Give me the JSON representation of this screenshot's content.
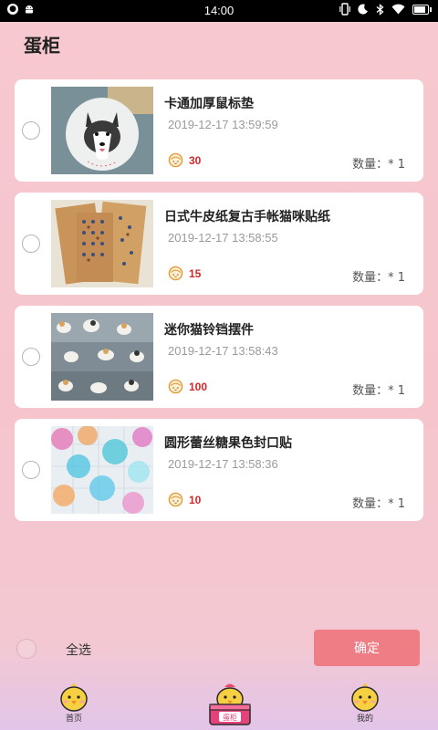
{
  "status_bar": {
    "time": "14:00",
    "left_icons": [
      "notification-dot-icon",
      "android-icon"
    ],
    "right_icons": [
      "vibrate-icon",
      "do-not-disturb-icon",
      "bluetooth-icon",
      "wifi-icon",
      "battery-icon"
    ],
    "battery_level": 0.85
  },
  "page": {
    "title": "蛋柜"
  },
  "items": [
    {
      "name": "卡通加厚鼠标垫",
      "time": "2019-12-17 13:59:59",
      "price": "30",
      "qty": "数量：* 1",
      "image": "husky-mousepad",
      "selected": false
    },
    {
      "name": "日式牛皮纸复古手帐猫咪贴纸",
      "time": "2019-12-17 13:58:55",
      "price": "15",
      "qty": "数量：* 1",
      "image": "kraft-stickers",
      "selected": false
    },
    {
      "name": "迷你猫铃铛摆件",
      "time": "2019-12-17 13:58:43",
      "price": "100",
      "qty": "数量：* 1",
      "image": "cat-figurines",
      "selected": false
    },
    {
      "name": "圆形蕾丝糖果色封口贴",
      "time": "2019-12-17 13:58:36",
      "price": "10",
      "qty": "数量：* 1",
      "image": "lace-seals",
      "selected": false
    }
  ],
  "footer": {
    "select_all": "全选",
    "confirm": "确定"
  },
  "tabs": [
    {
      "label": "首页",
      "icon": "chick-icon"
    },
    {
      "label": "蛋柜",
      "icon": "egg-cabinet-icon",
      "active": true
    },
    {
      "label": "我的",
      "icon": "chick-profile-icon"
    }
  ],
  "colors": {
    "accent": "#ee7d86",
    "price": "#d0282a",
    "background": "#f7c8cf"
  }
}
